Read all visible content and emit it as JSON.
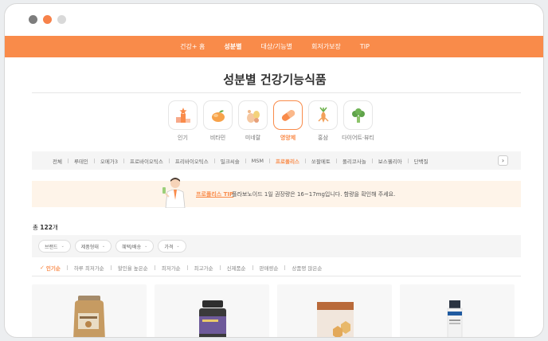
{
  "nav": {
    "items": [
      "건강+ 홈",
      "성분별",
      "대상/기능별",
      "회저가보장",
      "TIP"
    ],
    "active_index": 1
  },
  "page_title": "성분별 건강기능식품",
  "categories": [
    {
      "label": "인기",
      "icon": "trophy-icon"
    },
    {
      "label": "비타민",
      "icon": "orange-icon"
    },
    {
      "label": "미네랄",
      "icon": "mineral-icon"
    },
    {
      "label": "영양제",
      "icon": "capsule-icon",
      "active": true
    },
    {
      "label": "홍삼",
      "icon": "ginseng-icon"
    },
    {
      "label": "다이어트·뷰티",
      "icon": "broccoli-icon"
    }
  ],
  "subnav": {
    "items": [
      "전체",
      "루테인",
      "오메가3",
      "프로바이오틱스",
      "프리바이오틱스",
      "밀크씨슬",
      "MSM",
      "프로폴리스",
      "쏘팔메토",
      "폴리코사놀",
      "보스웰리아",
      "단백질"
    ],
    "active_index": 7,
    "next_arrow": "›"
  },
  "tip": {
    "label": "프로폴리스 TIP",
    "text": "플라보노이드 1일 권장량은 16~17mg입니다. 함량을 확인해 주세요."
  },
  "count": {
    "prefix": "총",
    "value": "122",
    "suffix": "개"
  },
  "filters": [
    "브랜드",
    "제품형태",
    "혜택/배송",
    "가격"
  ],
  "sort": {
    "items": [
      "인기순",
      "하루 최저가순",
      "할인율 높은순",
      "최저가순",
      "최고가순",
      "신제품순",
      "판매량순",
      "상품평 많은순"
    ],
    "active_index": 0,
    "check_mark": "✓"
  },
  "colors": {
    "accent": "#f98b4a",
    "tip_bg": "#fef4e9"
  }
}
